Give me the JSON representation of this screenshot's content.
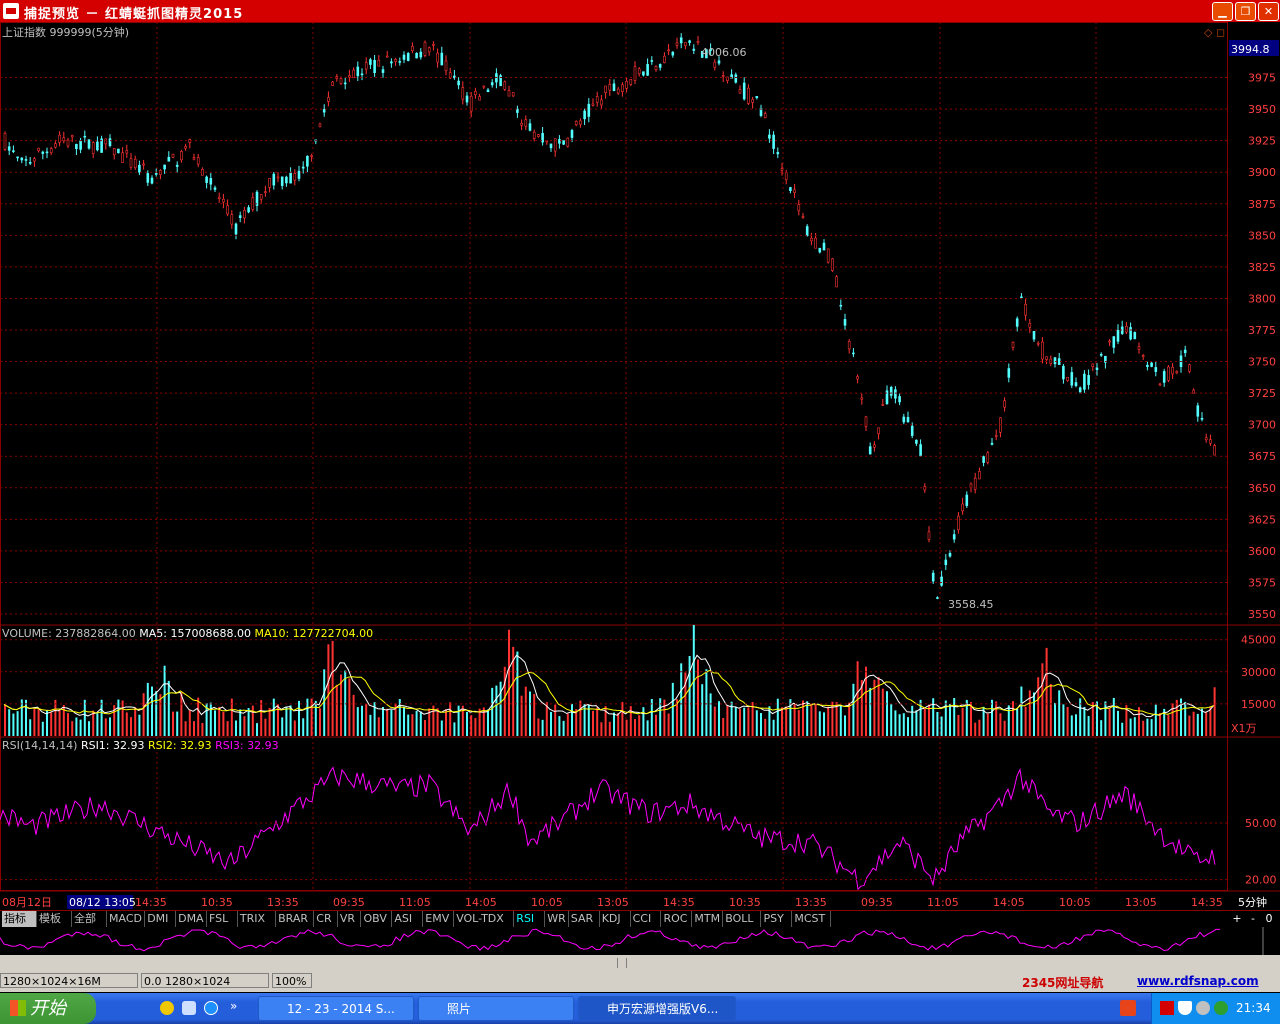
{
  "window": {
    "title": "捕捉预览 － 红蜻蜓抓图精灵2015"
  },
  "price_panel": {
    "title": "上证指数 999999(5分钟)",
    "current_price": "3994.8",
    "high_label": "4006.06",
    "low_label": "3558.45",
    "y_ticks": [
      "3975",
      "3950",
      "3925",
      "3900",
      "3875",
      "3850",
      "3825",
      "3800",
      "3775",
      "3750",
      "3725",
      "3700",
      "3675",
      "3650",
      "3625",
      "3600",
      "3575",
      "3550"
    ]
  },
  "volume_panel": {
    "volume_label": "VOLUME: 237882864.00",
    "ma5_label": "MA5: 157008688.00",
    "ma10_label": "MA10: 127722704.00",
    "y_ticks": [
      "45000",
      "30000",
      "15000"
    ],
    "unit": "X1万"
  },
  "rsi_panel": {
    "label": "RSI(14,14,14)",
    "rsi1": "RSI1: 32.93",
    "rsi2": "RSI2: 32.93",
    "rsi3": "RSI3: 32.93",
    "y_ticks": [
      "50.00",
      "20.00"
    ]
  },
  "time_axis": {
    "date": "08月12日",
    "cursor": "08/12 13:05",
    "labels": [
      "14:35",
      "10:35",
      "13:35",
      "09:35",
      "11:05",
      "14:05",
      "10:05",
      "13:05",
      "14:35",
      "10:35",
      "13:35",
      "09:35",
      "11:05",
      "14:05",
      "10:05",
      "13:05",
      "14:35"
    ],
    "period": "5分钟"
  },
  "indicator_tabs": [
    "指标",
    "模板",
    "全部",
    "MACD",
    "DMI",
    "DMA",
    "FSL",
    "TRIX",
    "BRAR",
    "CR",
    "VR",
    "OBV",
    "ASI",
    "EMV",
    "VOL-TDX",
    "RSI",
    "WR",
    "SAR",
    "KDJ",
    "CCI",
    "ROC",
    "MTM",
    "BOLL",
    "PSY",
    "MCST"
  ],
  "active_tab": "RSI",
  "tab_controls": [
    "+",
    "-",
    "0"
  ],
  "statusbar": {
    "dims": "1280×1024×16M",
    "cursor": "0.0 1280×1024",
    "zoom": "100%",
    "link1": "2345网址导航",
    "link2": "www.rdfsnap.com"
  },
  "taskbar": {
    "start": "开始",
    "tasks": [
      "12 - 23 - 2014 S...",
      "照片",
      "申万宏源增强版V6..."
    ],
    "clock": "21:34"
  },
  "colors": {
    "up": "#ff3232",
    "down": "#54ffff",
    "ma5": "#ffffff",
    "ma10": "#ffff00",
    "rsi": "#ff00ff",
    "grid": "#8a0000"
  }
}
